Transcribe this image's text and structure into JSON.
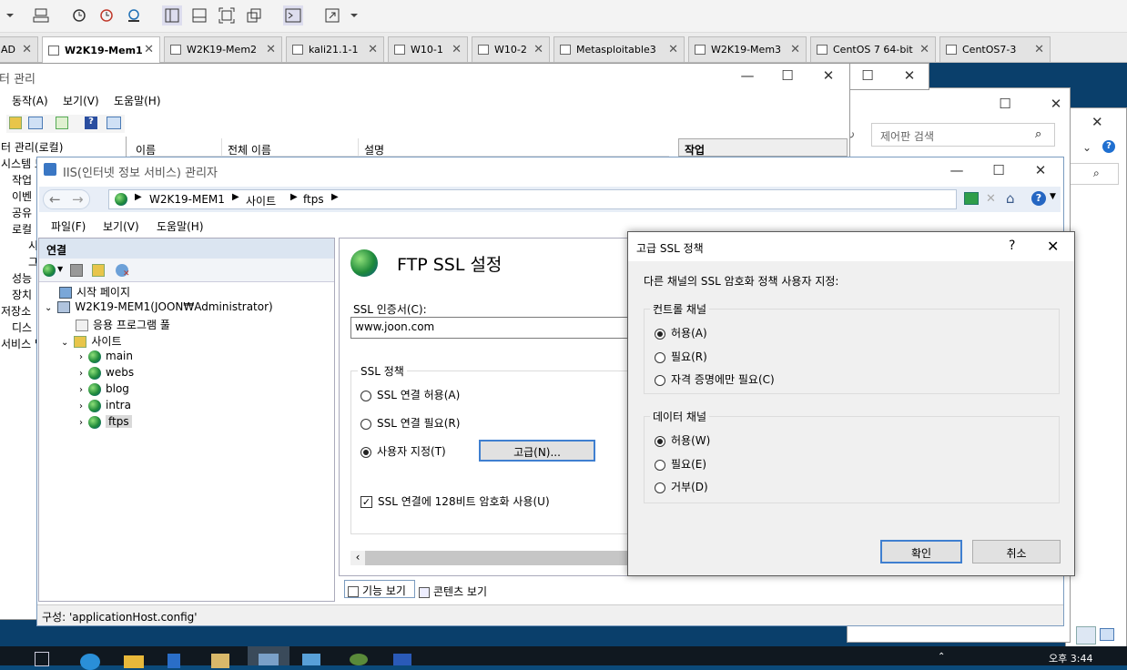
{
  "tabs": [
    {
      "label": "AD"
    },
    {
      "label": "W2K19-Mem1"
    },
    {
      "label": "W2K19-Mem2"
    },
    {
      "label": "kali21.1-1"
    },
    {
      "label": "W10-1"
    },
    {
      "label": "W10-2"
    },
    {
      "label": "Metasploitable3"
    },
    {
      "label": "W2K19-Mem3"
    },
    {
      "label": "CentOS 7 64-bit"
    },
    {
      "label": "CentOS7-3"
    }
  ],
  "bg_window": {
    "title": "터 관리",
    "menu": [
      "동작(A)",
      "보기(V)",
      "도움말(H)"
    ],
    "tree": [
      "터 관리(로컬)",
      "시스템 도",
      "작업",
      "이벤",
      "공유",
      "로컬",
      "시",
      "그",
      "성능",
      "장치",
      "저장소",
      "디스",
      "서비스 및"
    ],
    "columns": [
      "이름",
      "전체 이름",
      "설명"
    ],
    "actions_header": "작업"
  },
  "control_panel": {
    "search_placeholder": "제어판 검색"
  },
  "iis": {
    "title": "IIS(인터넷 정보 서비스) 관리자",
    "breadcrumb": [
      "W2K19-MEM1",
      "사이트",
      "ftps"
    ],
    "menu": [
      "파일(F)",
      "보기(V)",
      "도움말(H)"
    ],
    "connections_title": "연결",
    "tree": {
      "start_page": "시작 페이지",
      "server": "W2K19-MEM1(JOON₩Administrator)",
      "app_pool": "응용 프로그램 풀",
      "sites": "사이트",
      "site_list": [
        "main",
        "webs",
        "blog",
        "intra",
        "ftps"
      ]
    },
    "feature": {
      "title": "FTP SSL 설정",
      "cert_label": "SSL 인증서(C):",
      "cert_value": "www.joon.com",
      "policy_label": "SSL 정책",
      "opt_allow": "SSL 연결 허용(A)",
      "opt_require": "SSL 연결 필요(R)",
      "opt_custom": "사용자 지정(T)",
      "advanced_button": "고급(N)...",
      "use128": "SSL 연결에 128비트 암호화 사용(U)"
    },
    "view_tabs": [
      "기능 보기",
      "콘텐츠 보기"
    ],
    "status": "구성: 'applicationHost.config'"
  },
  "dialog": {
    "title": "고급 SSL 정책",
    "help": "?",
    "description": "다른 채널의 SSL 암호화 정책 사용자 지정:",
    "control_group": "컨트롤 채널",
    "control_opts": [
      "허용(A)",
      "필요(R)",
      "자격 증명에만 필요(C)"
    ],
    "data_group": "데이터 채널",
    "data_opts": [
      "허용(W)",
      "필요(E)",
      "거부(D)"
    ],
    "ok": "확인",
    "cancel": "취소"
  },
  "taskbar": {
    "time": "오후 3:44"
  }
}
